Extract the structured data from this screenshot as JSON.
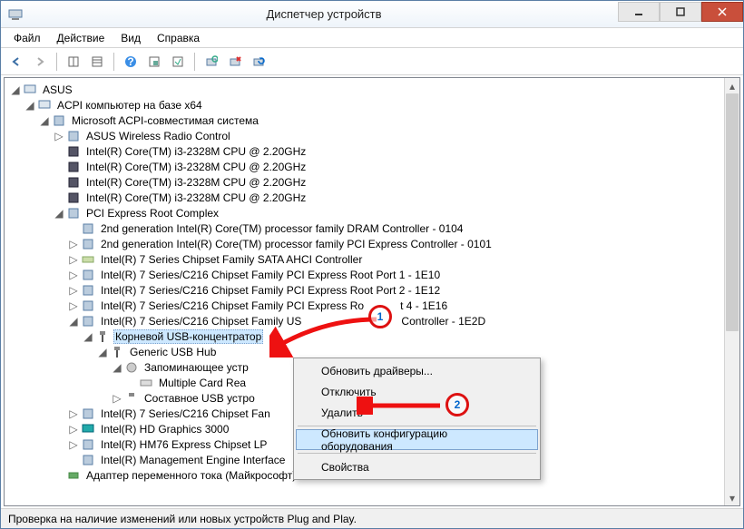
{
  "window": {
    "title": "Диспетчер устройств"
  },
  "menu": {
    "file": "Файл",
    "action": "Действие",
    "view": "Вид",
    "help": "Справка"
  },
  "status": {
    "text": "Проверка на наличие изменений или новых устройств Plug and Play."
  },
  "context_menu": {
    "update_drivers": "Обновить драйверы...",
    "disable": "Отключить",
    "delete": "Удалить",
    "scan_hw": "Обновить конфигурацию оборудования",
    "properties": "Свойства"
  },
  "tree": {
    "root": "ASUS",
    "n1": "ACPI компьютер на базе x64",
    "n2": "Microsoft ACPI-совместимая система",
    "n3": "ASUS Wireless Radio Control",
    "n4": "Intel(R) Core(TM) i3-2328M CPU @ 2.20GHz",
    "n5": "Intel(R) Core(TM) i3-2328M CPU @ 2.20GHz",
    "n6": "Intel(R) Core(TM) i3-2328M CPU @ 2.20GHz",
    "n7": "Intel(R) Core(TM) i3-2328M CPU @ 2.20GHz",
    "n8": "PCI Express Root Complex",
    "n9": "2nd generation Intel(R) Core(TM) processor family DRAM Controller - 0104",
    "n10": "2nd generation Intel(R) Core(TM) processor family PCI Express Controller - 0101",
    "n11": "Intel(R) 7 Series Chipset Family SATA AHCI Controller",
    "n12": "Intel(R) 7 Series/C216 Chipset Family PCI Express Root Port 1 - 1E10",
    "n13": "Intel(R) 7 Series/C216 Chipset Family PCI Express Root Port 2 - 1E12",
    "n14": "Intel(R) 7 Series/C216 Chipset Family PCI Express Ro",
    "n14b": "t 4 - 1E16",
    "n15": "Intel(R) 7 Series/C216 Chipset Family US",
    "n15b": "Controller - 1E2D",
    "n16": "Корневой USB-концентратор",
    "n17": "Generic USB Hub",
    "n18": "Запоминающее устр",
    "n19": "Multiple Card  Rea",
    "n20": "Составное USB устро",
    "n21": "Intel(R) 7 Series/C216 Chipset Fan",
    "n22": "Intel(R) HD Graphics 3000",
    "n23": "Intel(R) HM76 Express Chipset LP",
    "n24": "Intel(R) Management Engine Interface",
    "n25": "Адаптер переменного тока (Майкрософт)"
  },
  "annotations": {
    "b1": "1",
    "b2": "2"
  }
}
